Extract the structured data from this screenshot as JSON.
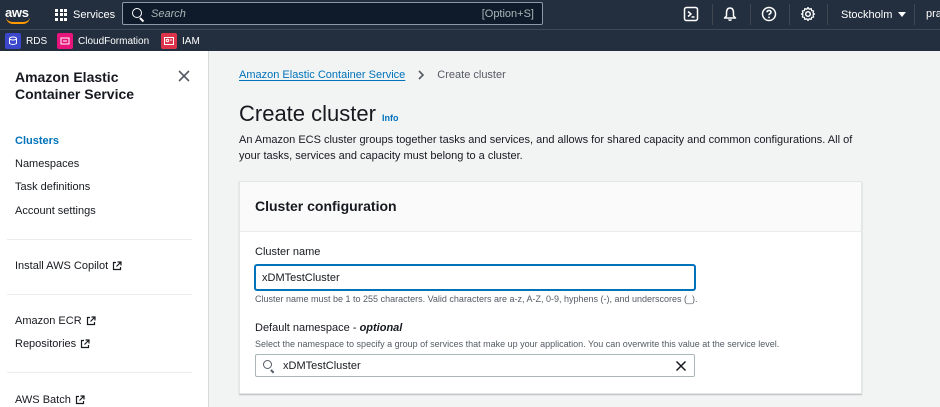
{
  "topnav": {
    "logo_text": "aws",
    "services_label": "Services",
    "search_placeholder": "Search",
    "search_shortcut": "[Option+S]",
    "region": "Stockholm",
    "user": "pra"
  },
  "favorites": [
    {
      "label": "RDS",
      "color": "#3b48cc"
    },
    {
      "label": "CloudFormation",
      "color": "#e7157b"
    },
    {
      "label": "IAM",
      "color": "#dd344c"
    }
  ],
  "sidebar": {
    "title": "Amazon Elastic Container Service",
    "items": [
      {
        "label": "Clusters",
        "active": true
      },
      {
        "label": "Namespaces"
      },
      {
        "label": "Task definitions"
      },
      {
        "label": "Account settings"
      },
      {
        "label": "Install AWS Copilot",
        "external": true
      },
      {
        "label": "Amazon ECR",
        "external": true
      },
      {
        "label": "Repositories",
        "external": true
      },
      {
        "label": "AWS Batch",
        "external": true
      }
    ]
  },
  "breadcrumb": {
    "parent": "Amazon Elastic Container Service",
    "current": "Create cluster"
  },
  "page": {
    "title": "Create cluster",
    "info": "Info",
    "description": "An Amazon ECS cluster groups together tasks and services, and allows for shared capacity and common configurations. All of your tasks, services and capacity must belong to a cluster."
  },
  "config": {
    "section_title": "Cluster configuration",
    "cluster_name_label": "Cluster name",
    "cluster_name_value": "xDMTestCluster",
    "cluster_name_hint": "Cluster name must be 1 to 255 characters. Valid characters are a-z, A-Z, 0-9, hyphens (-), and underscores (_).",
    "namespace_label": "Default namespace - ",
    "namespace_optional": "optional",
    "namespace_hint": "Select the namespace to specify a group of services that make up your application. You can overwrite this value at the service level.",
    "namespace_value": "xDMTestCluster"
  },
  "colors": {
    "nav_bg": "#232f3e",
    "link": "#0073bb",
    "accent": "#ff9900"
  }
}
